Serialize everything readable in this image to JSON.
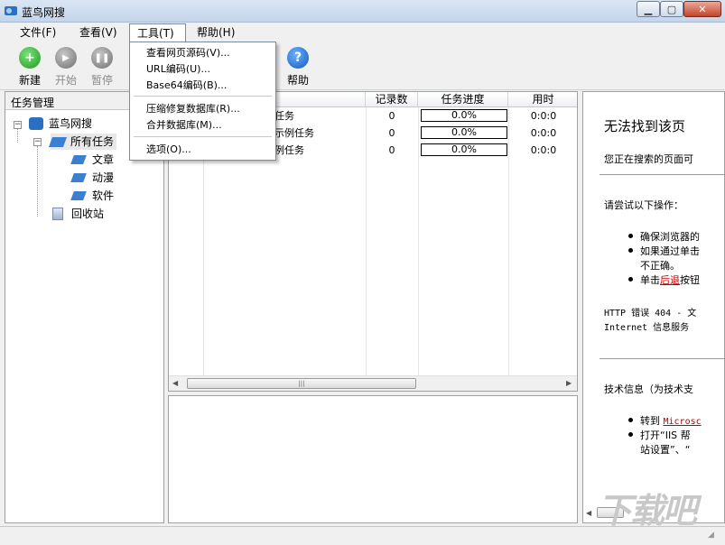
{
  "window": {
    "title": "蓝鸟网搜"
  },
  "menu": {
    "file": "文件(F)",
    "view": "查看(V)",
    "tools": "工具(T)",
    "help": "帮助(H)"
  },
  "tools_menu": {
    "items": [
      "查看网页源码(V)...",
      "URL编码(U)...",
      "Base64编码(B)...",
      "压缩修复数据库(R)...",
      "合并数据库(M)...",
      "选项(O)..."
    ]
  },
  "toolbar": {
    "new": "新建",
    "start": "开始",
    "pause": "暂停",
    "help": "帮助"
  },
  "sidebar": {
    "header": "任务管理",
    "root": "蓝鸟网搜",
    "all_tasks": "所有任务",
    "categories": [
      "文章",
      "动漫",
      "软件"
    ],
    "recycle": "回收站"
  },
  "grid": {
    "columns": {
      "records": "记录数",
      "progress": "任务进度",
      "time": "用时"
    },
    "rows": [
      {
        "name": "任务",
        "records": "0",
        "progress": "0.0%",
        "time": "0:0:0"
      },
      {
        "name": "示例任务",
        "records": "0",
        "progress": "0.0%",
        "time": "0:0:0"
      },
      {
        "name": "例任务",
        "records": "0",
        "progress": "0.0%",
        "time": "0:0:0"
      }
    ]
  },
  "browser": {
    "heading": "无法找到该页",
    "line1": "您正在搜索的页面可",
    "try": "请尝试以下操作：",
    "b1": "确保浏览器的",
    "b2a": "如果通过单击",
    "b2b": "不正确。",
    "b3a": "单击",
    "b3link": "后退",
    "b3b": "按钮",
    "err1": "HTTP 错误 404 - 文",
    "err2": "Internet 信息服务",
    "tech": "技术信息（为技术支",
    "t1a": "转到 ",
    "t1link": "Microsc",
    "t2a": "打开“IIS 帮",
    "t2b": "站设置”、“"
  },
  "watermark": "下载吧"
}
